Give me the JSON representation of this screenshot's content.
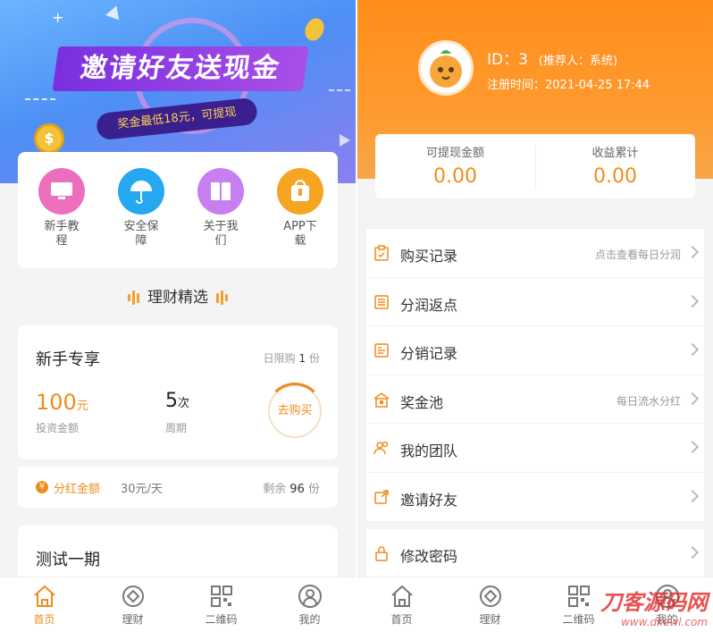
{
  "left": {
    "banner": {
      "title": "邀请好友送现金",
      "subtitle": "奖金最低18元，可提现"
    },
    "quick_links": [
      {
        "label": "新手教程",
        "icon": "monitor-icon",
        "color": "#ec6fbd"
      },
      {
        "label": "安全保障",
        "icon": "umbrella-icon",
        "color": "#26a8f0"
      },
      {
        "label": "关于我们",
        "icon": "book-icon",
        "color": "#c77ef0"
      },
      {
        "label": "APP下载",
        "icon": "download-icon",
        "color": "#f5a522"
      }
    ],
    "section_title": "理财精选",
    "product": {
      "name": "新手专享",
      "limit_label": "日限购",
      "limit_value": "1",
      "limit_unit": "份",
      "amount": "100",
      "amount_unit": "元",
      "amount_label": "投资金额",
      "cycle": "5",
      "cycle_unit": "次",
      "cycle_label": "周期",
      "buy_label": "去购买",
      "mode_icon": "￥",
      "mode": "分红金额",
      "rate": "30元/天",
      "remain_label": "剩余",
      "remain_value": "96",
      "remain_unit": "份"
    },
    "product2": {
      "name": "测试一期"
    },
    "tabs": [
      {
        "label": "首页",
        "icon": "home-icon",
        "active": true
      },
      {
        "label": "理财",
        "icon": "finance-icon",
        "active": false
      },
      {
        "label": "二维码",
        "icon": "qrcode-icon",
        "active": false
      },
      {
        "label": "我的",
        "icon": "user-icon",
        "active": false
      }
    ]
  },
  "right": {
    "user": {
      "id_text": "ID：3",
      "referrer_text": "(推荐人：系统)",
      "reg_label": "注册时间：",
      "reg_time": "2021-04-25 17:44"
    },
    "balances": [
      {
        "label": "可提现金额",
        "value": "0.00"
      },
      {
        "label": "收益累计",
        "value": "0.00"
      }
    ],
    "menu": [
      {
        "label": "购买记录",
        "hint": "点击查看每日分润",
        "icon": "clipboard-icon"
      },
      {
        "label": "分润返点",
        "hint": "",
        "icon": "list-icon"
      },
      {
        "label": "分销记录",
        "hint": "",
        "icon": "document-icon"
      },
      {
        "label": "奖金池",
        "hint": "每日流水分红",
        "icon": "house-icon"
      },
      {
        "label": "我的团队",
        "hint": "",
        "icon": "team-icon"
      },
      {
        "label": "邀请好友",
        "hint": "",
        "icon": "share-icon"
      },
      {
        "label": "修改密码",
        "hint": "",
        "icon": "lock-icon"
      }
    ],
    "tabs": [
      {
        "label": "首页",
        "icon": "home-icon"
      },
      {
        "label": "理财",
        "icon": "finance-icon"
      },
      {
        "label": "二维码",
        "icon": "qrcode-icon"
      },
      {
        "label": "我的",
        "icon": "user-icon"
      }
    ],
    "watermark": {
      "big": "刀客源码网",
      "small": "www.dkewl.com"
    }
  },
  "colors": {
    "accent": "#f08c1e",
    "hero_orange": "#ff8d1c",
    "banner_purple": "#7a2fe0"
  }
}
